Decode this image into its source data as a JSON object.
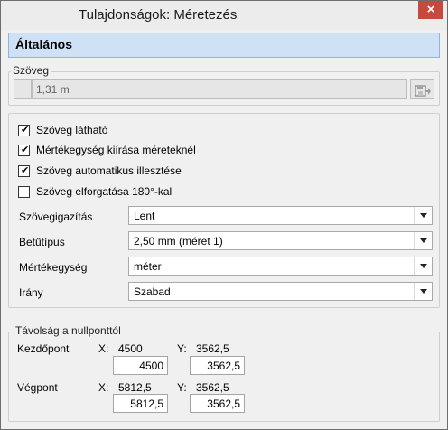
{
  "window": {
    "title": "Tulajdonságok: Méretezés",
    "close_glyph": "×"
  },
  "section": {
    "title": "Általános"
  },
  "text_group": {
    "label": "Szöveg",
    "value": "1,31 m",
    "icon": "save-to-folder-icon"
  },
  "checkboxes": [
    {
      "label": "Szöveg látható",
      "checked": true
    },
    {
      "label": "Mértékegység kiírása méreteknél",
      "checked": true
    },
    {
      "label": "Szöveg automatikus illesztése",
      "checked": true
    },
    {
      "label": "Szöveg elforgatása 180°-kal",
      "checked": false
    }
  ],
  "properties": [
    {
      "label": "Szövegigazítás",
      "value": "Lent"
    },
    {
      "label": "Betűtípus",
      "value": "2,50 mm (méret 1)"
    },
    {
      "label": "Mértékegység",
      "value": "méter"
    },
    {
      "label": "Irány",
      "value": "Szabad"
    }
  ],
  "distance_group": {
    "label": "Távolság a nullponttól",
    "start": {
      "label": "Kezdőpont",
      "x_label": "X:",
      "x_value": "4500",
      "y_label": "Y:",
      "y_value": "3562,5",
      "x_input": "4500",
      "y_input": "3562,5"
    },
    "end": {
      "label": "Végpont",
      "x_label": "X:",
      "x_value": "5812,5",
      "y_label": "Y:",
      "y_value": "3562,5",
      "x_input": "5812,5",
      "y_input": "3562,5"
    }
  },
  "colors": {
    "header_bg": "#cfe1f5",
    "close_button": "#c7493e"
  }
}
